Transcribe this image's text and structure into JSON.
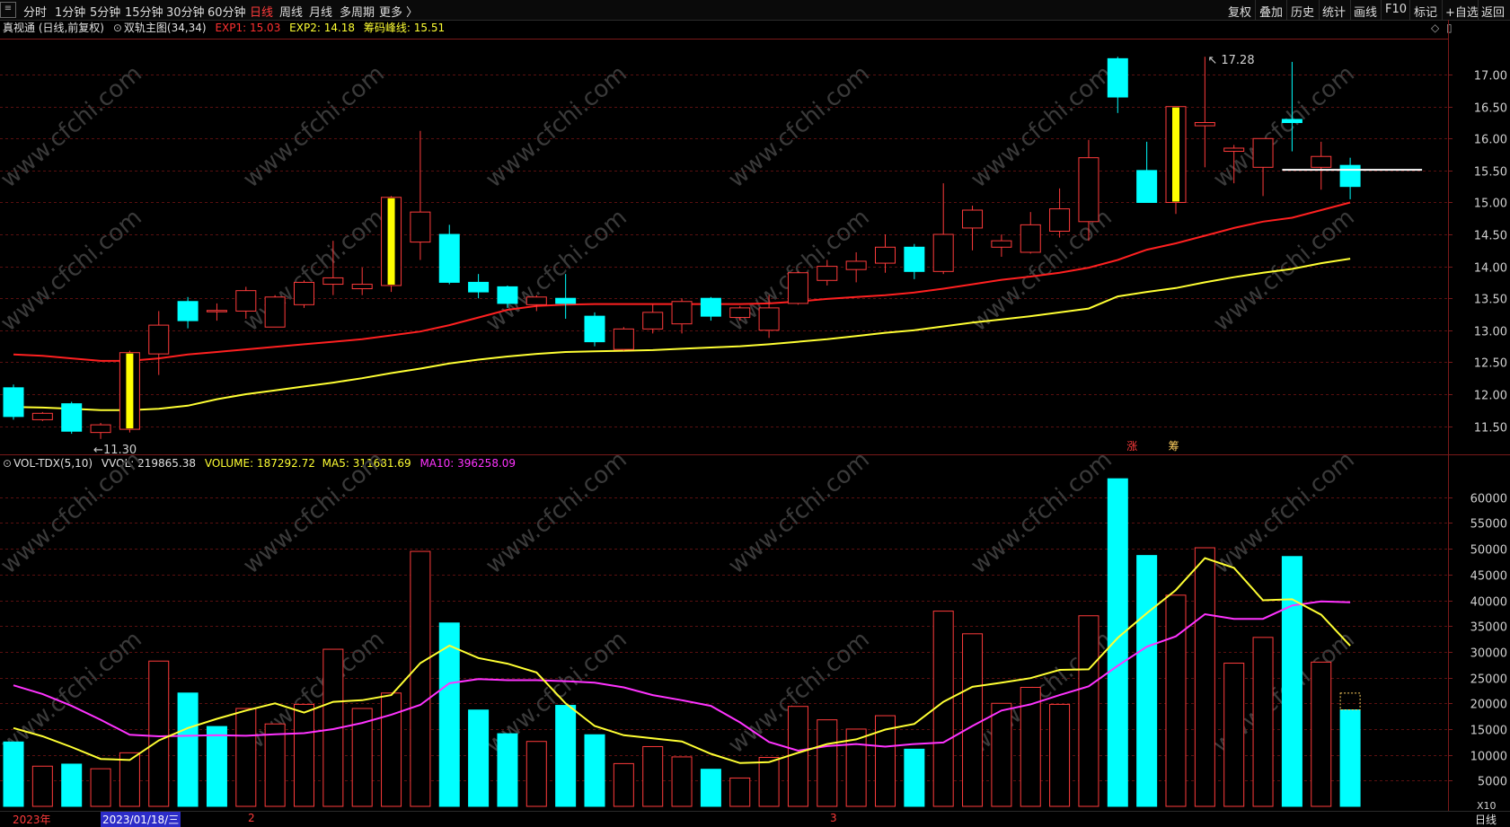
{
  "toolbar": {
    "menu_glyph": "≡",
    "periods": [
      "分时",
      "1分钟",
      "5分钟",
      "15分钟",
      "30分钟",
      "60分钟",
      "日线",
      "周线",
      "月线",
      "多周期",
      "更多 〉"
    ],
    "active_period": "日线",
    "right_tools": [
      "复权",
      "叠加",
      "历史",
      "统计",
      "画线",
      "F10",
      "标记",
      "+自选",
      "返回"
    ]
  },
  "price_panel": {
    "title": "真视通 (日线,前复权)",
    "indicator": "双轨主图(34,34)",
    "exp1": "EXP1: 15.03",
    "exp2": "EXP2: 14.18",
    "chip": "筹码峰线: 15.51",
    "high_label": "17.28",
    "low_label": "11.30",
    "marker_up": "涨",
    "marker_chip": "筹",
    "diamond_glyph": "◇",
    "window_glyph": "▯"
  },
  "volume_panel": {
    "title": "VOL-TDX(5,10)",
    "vvol": "VVOL: 219865.38",
    "volume": "VOLUME: 187292.72",
    "ma5": "MA5: 311681.69",
    "ma10": "MA10: 396258.09",
    "scale_tag": "X10"
  },
  "bottom": {
    "year": "2023年",
    "date_sel": "2023/01/18/三",
    "month2": "2",
    "month3": "3",
    "period": "日线"
  },
  "watermark": "www.cfchi.com",
  "colors": {
    "up": "#ff3b3b",
    "down": "#00ffff",
    "exp1": "#ff2020",
    "exp2": "#ffff33",
    "ma5": "#ffff33",
    "ma10": "#ff33ff",
    "chip": "#ffffff",
    "highlight": "#ffff00"
  },
  "chart_data": [
    {
      "type": "candlestick",
      "title": "真视通 (日线,前复权)",
      "ylim": [
        11.1,
        17.55
      ],
      "yticks": [
        11.5,
        12.0,
        12.5,
        13.0,
        13.5,
        14.0,
        14.5,
        15.0,
        15.5,
        16.0,
        16.5,
        17.0
      ],
      "chip_line": 15.51,
      "candles": [
        {
          "o": 12.1,
          "h": 12.15,
          "l": 11.6,
          "c": 11.65,
          "hl": false
        },
        {
          "o": 11.6,
          "h": 11.72,
          "l": 11.58,
          "c": 11.7,
          "hl": false
        },
        {
          "o": 11.85,
          "h": 11.88,
          "l": 11.38,
          "c": 11.42,
          "hl": false
        },
        {
          "o": 11.4,
          "h": 11.55,
          "l": 11.3,
          "c": 11.52,
          "hl": false
        },
        {
          "o": 11.45,
          "h": 12.68,
          "l": 11.4,
          "c": 12.65,
          "hl": true
        },
        {
          "o": 12.63,
          "h": 13.3,
          "l": 12.3,
          "c": 13.08,
          "hl": false
        },
        {
          "o": 13.45,
          "h": 13.52,
          "l": 13.03,
          "c": 13.15,
          "hl": false
        },
        {
          "o": 13.3,
          "h": 13.42,
          "l": 13.15,
          "c": 13.31,
          "hl": false
        },
        {
          "o": 13.3,
          "h": 13.68,
          "l": 13.18,
          "c": 13.62,
          "hl": false
        },
        {
          "o": 13.05,
          "h": 13.55,
          "l": 13.05,
          "c": 13.52,
          "hl": false
        },
        {
          "o": 13.4,
          "h": 13.78,
          "l": 13.35,
          "c": 13.75,
          "hl": false
        },
        {
          "o": 13.72,
          "h": 14.4,
          "l": 13.55,
          "c": 13.82,
          "hl": false
        },
        {
          "o": 13.65,
          "h": 13.98,
          "l": 13.55,
          "c": 13.72,
          "hl": false
        },
        {
          "o": 13.7,
          "h": 15.1,
          "l": 13.6,
          "c": 15.08,
          "hl": true
        },
        {
          "o": 14.38,
          "h": 16.12,
          "l": 14.1,
          "c": 14.85,
          "hl": false
        },
        {
          "o": 14.5,
          "h": 14.65,
          "l": 13.72,
          "c": 13.75,
          "hl": false
        },
        {
          "o": 13.75,
          "h": 13.88,
          "l": 13.5,
          "c": 13.6,
          "hl": false
        },
        {
          "o": 13.68,
          "h": 13.7,
          "l": 13.35,
          "c": 13.42,
          "hl": false
        },
        {
          "o": 13.4,
          "h": 13.55,
          "l": 13.3,
          "c": 13.52,
          "hl": false
        },
        {
          "o": 13.5,
          "h": 13.88,
          "l": 13.18,
          "c": 13.42,
          "hl": false
        },
        {
          "o": 13.22,
          "h": 13.28,
          "l": 12.75,
          "c": 12.82,
          "hl": false
        },
        {
          "o": 12.7,
          "h": 13.05,
          "l": 12.68,
          "c": 13.02,
          "hl": false
        },
        {
          "o": 13.02,
          "h": 13.4,
          "l": 12.95,
          "c": 13.28,
          "hl": false
        },
        {
          "o": 13.1,
          "h": 13.5,
          "l": 12.95,
          "c": 13.45,
          "hl": false
        },
        {
          "o": 13.5,
          "h": 13.52,
          "l": 13.15,
          "c": 13.22,
          "hl": false
        },
        {
          "o": 13.2,
          "h": 13.38,
          "l": 13.15,
          "c": 13.35,
          "hl": false
        },
        {
          "o": 13.0,
          "h": 13.55,
          "l": 12.88,
          "c": 13.35,
          "hl": false
        },
        {
          "o": 13.42,
          "h": 13.92,
          "l": 13.4,
          "c": 13.9,
          "hl": false
        },
        {
          "o": 13.78,
          "h": 14.1,
          "l": 13.7,
          "c": 14.0,
          "hl": false
        },
        {
          "o": 13.95,
          "h": 14.22,
          "l": 13.75,
          "c": 14.08,
          "hl": false
        },
        {
          "o": 14.05,
          "h": 14.5,
          "l": 13.9,
          "c": 14.3,
          "hl": false
        },
        {
          "o": 14.3,
          "h": 14.35,
          "l": 13.8,
          "c": 13.92,
          "hl": false
        },
        {
          "o": 13.92,
          "h": 15.3,
          "l": 13.88,
          "c": 14.5,
          "hl": false
        },
        {
          "o": 14.6,
          "h": 14.95,
          "l": 14.25,
          "c": 14.88,
          "hl": false
        },
        {
          "o": 14.3,
          "h": 14.5,
          "l": 14.15,
          "c": 14.4,
          "hl": false
        },
        {
          "o": 14.22,
          "h": 14.85,
          "l": 14.2,
          "c": 14.65,
          "hl": false
        },
        {
          "o": 14.55,
          "h": 15.22,
          "l": 14.45,
          "c": 14.9,
          "hl": false
        },
        {
          "o": 14.7,
          "h": 15.98,
          "l": 14.4,
          "c": 15.7,
          "hl": false
        },
        {
          "o": 17.25,
          "h": 17.28,
          "l": 16.4,
          "c": 16.65,
          "hl": false
        },
        {
          "o": 15.5,
          "h": 15.95,
          "l": 15.0,
          "c": 15.0,
          "hl": false
        },
        {
          "o": 15.0,
          "h": 16.5,
          "l": 14.82,
          "c": 16.5,
          "hl": true
        },
        {
          "o": 16.2,
          "h": 17.28,
          "l": 15.55,
          "c": 16.25,
          "hl": false
        },
        {
          "o": 15.8,
          "h": 15.9,
          "l": 15.3,
          "c": 15.85,
          "hl": false
        },
        {
          "o": 15.55,
          "h": 16.0,
          "l": 15.1,
          "c": 16.0,
          "hl": false
        },
        {
          "o": 16.3,
          "h": 17.2,
          "l": 15.8,
          "c": 16.25,
          "hl": false
        },
        {
          "o": 15.55,
          "h": 15.95,
          "l": 15.2,
          "c": 15.72,
          "hl": false
        },
        {
          "o": 15.58,
          "h": 15.7,
          "l": 15.05,
          "c": 15.25,
          "hl": false
        }
      ],
      "exp1": [
        12.62,
        12.6,
        12.56,
        12.52,
        12.52,
        12.56,
        12.62,
        12.66,
        12.7,
        12.74,
        12.78,
        12.82,
        12.86,
        12.92,
        12.98,
        13.08,
        13.2,
        13.32,
        13.38,
        13.4,
        13.41,
        13.41,
        13.41,
        13.41,
        13.41,
        13.41,
        13.42,
        13.45,
        13.49,
        13.52,
        13.55,
        13.59,
        13.65,
        13.72,
        13.79,
        13.84,
        13.9,
        13.98,
        14.1,
        14.26,
        14.36,
        14.48,
        14.6,
        14.7,
        14.76,
        14.88,
        15.0,
        15.03
      ],
      "exp2": [
        11.8,
        11.79,
        11.77,
        11.75,
        11.75,
        11.77,
        11.82,
        11.92,
        12.0,
        12.06,
        12.12,
        12.18,
        12.25,
        12.33,
        12.4,
        12.48,
        12.54,
        12.59,
        12.63,
        12.66,
        12.67,
        12.68,
        12.69,
        12.71,
        12.73,
        12.75,
        12.78,
        12.82,
        12.86,
        12.91,
        12.96,
        13.0,
        13.06,
        13.12,
        13.17,
        13.22,
        13.28,
        13.34,
        13.53,
        13.6,
        13.66,
        13.75,
        13.83,
        13.9,
        13.96,
        14.05,
        14.12,
        14.18
      ]
    },
    {
      "type": "bar",
      "title": "VOL-TDX(5,10)",
      "ylim": [
        0,
        64500
      ],
      "yticks": [
        5000,
        10000,
        15000,
        20000,
        25000,
        30000,
        35000,
        40000,
        45000,
        50000,
        55000,
        60000
      ],
      "bars": [
        {
          "v": 12500,
          "up": false
        },
        {
          "v": 7800,
          "up": true
        },
        {
          "v": 8200,
          "up": false
        },
        {
          "v": 7300,
          "up": true
        },
        {
          "v": 10400,
          "up": true
        },
        {
          "v": 28200,
          "up": true
        },
        {
          "v": 22000,
          "up": false
        },
        {
          "v": 15500,
          "up": false
        },
        {
          "v": 19000,
          "up": true
        },
        {
          "v": 16000,
          "up": true
        },
        {
          "v": 19800,
          "up": true
        },
        {
          "v": 30500,
          "up": true
        },
        {
          "v": 19000,
          "up": true
        },
        {
          "v": 22000,
          "up": true
        },
        {
          "v": 49500,
          "up": true
        },
        {
          "v": 35600,
          "up": false
        },
        {
          "v": 18700,
          "up": false
        },
        {
          "v": 14100,
          "up": false
        },
        {
          "v": 12600,
          "up": true
        },
        {
          "v": 19600,
          "up": false
        },
        {
          "v": 13900,
          "up": false
        },
        {
          "v": 8300,
          "up": true
        },
        {
          "v": 11600,
          "up": true
        },
        {
          "v": 9600,
          "up": true
        },
        {
          "v": 7200,
          "up": false
        },
        {
          "v": 5500,
          "up": true
        },
        {
          "v": 9500,
          "up": true
        },
        {
          "v": 19400,
          "up": true
        },
        {
          "v": 16800,
          "up": true
        },
        {
          "v": 15000,
          "up": true
        },
        {
          "v": 17600,
          "up": true
        },
        {
          "v": 11100,
          "up": false
        },
        {
          "v": 37900,
          "up": true
        },
        {
          "v": 33500,
          "up": true
        },
        {
          "v": 20000,
          "up": true
        },
        {
          "v": 23100,
          "up": true
        },
        {
          "v": 19800,
          "up": true
        },
        {
          "v": 37000,
          "up": true
        },
        {
          "v": 63600,
          "up": false
        },
        {
          "v": 48700,
          "up": false
        },
        {
          "v": 41000,
          "up": true
        },
        {
          "v": 50200,
          "up": true
        },
        {
          "v": 27800,
          "up": true
        },
        {
          "v": 32800,
          "up": true
        },
        {
          "v": 48500,
          "up": false
        },
        {
          "v": 28000,
          "up": true
        },
        {
          "v": 18729,
          "up": false
        }
      ],
      "vvol_last": 21987,
      "ma5": [
        15200,
        13600,
        11500,
        9200,
        9000,
        12800,
        15200,
        17000,
        18600,
        20000,
        18200,
        20300,
        20600,
        21600,
        27800,
        31200,
        28800,
        27700,
        26000,
        20000,
        15600,
        13800,
        13200,
        12600,
        10200,
        8400,
        8600,
        10400,
        12100,
        13000,
        14900,
        16000,
        20300,
        23200,
        24000,
        24900,
        26500,
        26600,
        32700,
        37500,
        42000,
        48200,
        46300,
        40000,
        40200,
        37200,
        31168
      ],
      "ma10": [
        23500,
        21800,
        19500,
        16800,
        13900,
        13600,
        13700,
        13800,
        13700,
        14000,
        14200,
        15000,
        16200,
        17800,
        19700,
        23900,
        24700,
        24500,
        24500,
        24300,
        24000,
        23100,
        21600,
        20600,
        19500,
        16300,
        12500,
        10800,
        11700,
        12100,
        11600,
        12100,
        12400,
        15600,
        18600,
        19800,
        21600,
        23300,
        27300,
        31000,
        33000,
        37300,
        36400,
        36400,
        39000,
        39800,
        39626
      ]
    }
  ]
}
